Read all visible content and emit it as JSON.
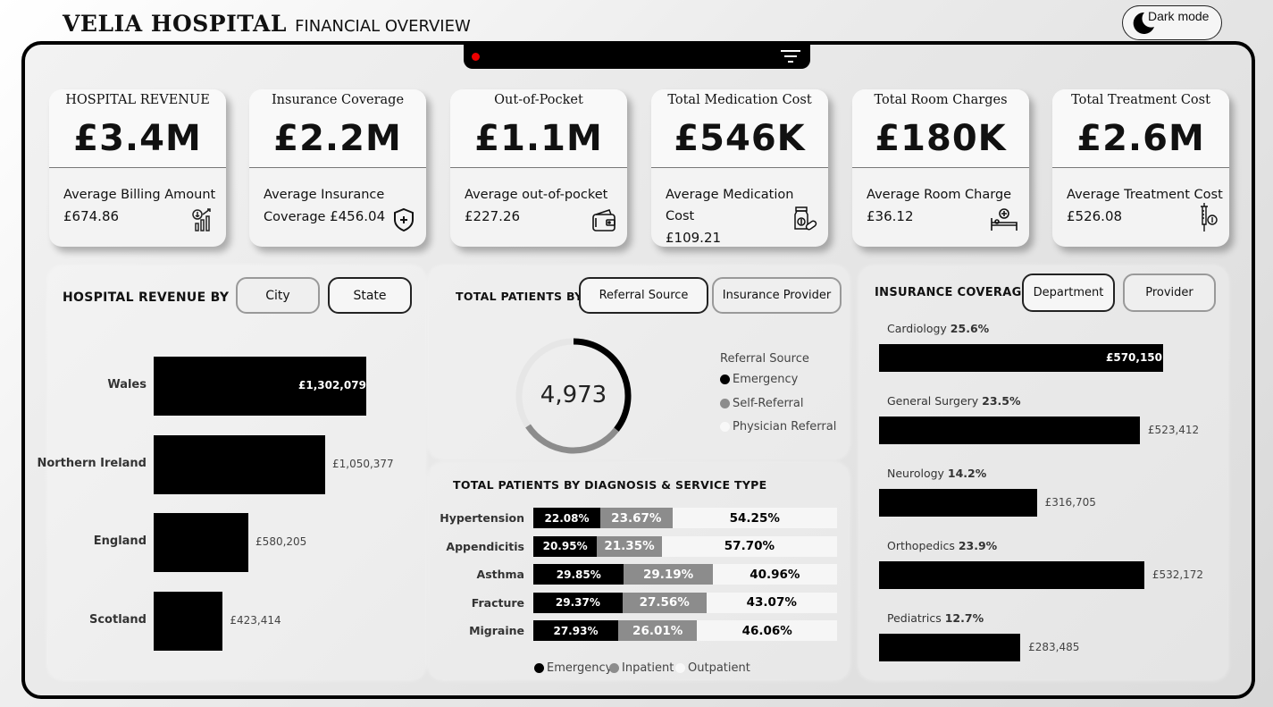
{
  "header": {
    "title_main": "VELIA HOSPITAL",
    "title_sub": "FINANCIAL OVERVIEW",
    "dark_mode_label": "Dark mode"
  },
  "kpis": [
    {
      "title": "HOSPITAL REVENUE",
      "value": "£3.4M",
      "avg_label": "Average Billing Amount",
      "avg_value": "£674.86",
      "icon": "revenue-chart-icon"
    },
    {
      "title": "Insurance Coverage",
      "value": "£2.2M",
      "avg_label": "Average Insurance Coverage",
      "avg_value": "£456.04",
      "icon": "shield-plus-icon"
    },
    {
      "title": "Out-of-Pocket",
      "value": "£1.1M",
      "avg_label": "Average out-of-pocket",
      "avg_value": "£227.26",
      "icon": "wallet-icon"
    },
    {
      "title": "Total Medication Cost",
      "value": "£546K",
      "avg_label": "Average Medication Cost",
      "avg_value": "£109.21",
      "icon": "medication-bottle-icon"
    },
    {
      "title": "Total Room Charges",
      "value": "£180K",
      "avg_label": "Average Room Charge",
      "avg_value": "£36.12",
      "icon": "hospital-bed-icon"
    },
    {
      "title": "Total Treatment Cost",
      "value": "£2.6M",
      "avg_label": "Average Treatment Cost",
      "avg_value": "£526.08",
      "icon": "syringe-icon"
    }
  ],
  "revenue_panel": {
    "title": "HOSPITAL REVENUE BY",
    "toggle": [
      "City",
      "State"
    ],
    "active": "State"
  },
  "patients_panel": {
    "title": "TOTAL PATIENTS BY",
    "toggle": [
      "Referral Source",
      "Insurance Provider"
    ],
    "active": "Referral Source",
    "total": "4,973",
    "legend_title": "Referral Source",
    "legend": [
      "Emergency",
      "Self-Referral",
      "Physician Referral"
    ]
  },
  "diagnosis_panel": {
    "title": "TOTAL PATIENTS BY DIAGNOSIS & SERVICE TYPE",
    "legend": [
      "Emergency",
      "Inpatient",
      "Outpatient"
    ]
  },
  "insurance_panel": {
    "title": "INSURANCE COVERAGE",
    "toggle": [
      "Department",
      "Provider"
    ],
    "active": "Department"
  },
  "colors": {
    "bar": "#000000",
    "inpatient": "#8c8c8c",
    "outpatient": "#f6f6f6",
    "alert_dot": "#e00000"
  },
  "chart_data": [
    {
      "type": "bar",
      "orientation": "horizontal",
      "title": "HOSPITAL REVENUE BY",
      "categories": [
        "Wales",
        "Northern Ireland",
        "England",
        "Scotland"
      ],
      "values": [
        1302079,
        1050377,
        580205,
        423414
      ],
      "value_labels": [
        "£1,302,079",
        "£1,050,377",
        "£580,205",
        "£423,414"
      ]
    },
    {
      "type": "pie",
      "subtype": "donut",
      "title": "TOTAL PATIENTS BY",
      "categories": [
        "Emergency",
        "Self-Referral",
        "Physician Referral"
      ],
      "values": [
        1770,
        1500,
        1703
      ],
      "center_label": "4,973"
    },
    {
      "type": "bar",
      "orientation": "horizontal",
      "stacked": "percent",
      "title": "TOTAL PATIENTS BY DIAGNOSIS & SERVICE TYPE",
      "categories": [
        "Hypertension",
        "Appendicitis",
        "Asthma",
        "Fracture",
        "Migraine"
      ],
      "series": [
        {
          "name": "Emergency",
          "values": [
            22.08,
            20.95,
            29.85,
            29.37,
            27.93
          ],
          "labels": [
            "22.08%",
            "20.95%",
            "29.85%",
            "29.37%",
            "27.93%"
          ]
        },
        {
          "name": "Inpatient",
          "values": [
            23.67,
            21.35,
            29.19,
            27.56,
            26.01
          ],
          "labels": [
            "23.67%",
            "21.35%",
            "29.19%",
            "27.56%",
            "26.01%"
          ]
        },
        {
          "name": "Outpatient",
          "values": [
            54.25,
            57.7,
            40.96,
            43.07,
            46.06
          ],
          "labels": [
            "54.25%",
            "57.70%",
            "40.96%",
            "43.07%",
            "46.06%"
          ]
        }
      ]
    },
    {
      "type": "bar",
      "orientation": "horizontal",
      "title": "INSURANCE COVERAGE",
      "categories": [
        "Cardiology",
        "General Surgery",
        "Neurology",
        "Orthopedics",
        "Pediatrics"
      ],
      "shares": [
        "25.6%",
        "23.5%",
        "14.2%",
        "23.9%",
        "12.7%"
      ],
      "values": [
        570150,
        523412,
        316705,
        532172,
        283485
      ],
      "value_labels": [
        "£570,150",
        "£523,412",
        "£316,705",
        "£532,172",
        "£283,485"
      ]
    }
  ]
}
